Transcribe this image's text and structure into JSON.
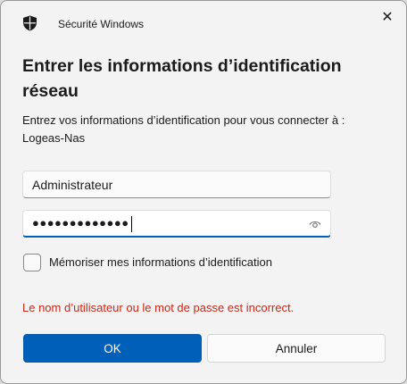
{
  "window": {
    "title": "Sécurité Windows",
    "close_glyph": "✕"
  },
  "dialog": {
    "heading_line1": "Entrer les informations d’identification",
    "heading_line2": "réseau",
    "description_line1": "Entrez vos informations d’identification pour vous connecter à :",
    "description_line2": "Logeas-Nas"
  },
  "form": {
    "username_value": "Administrateur",
    "password_masked": "●●●●●●●●●●●●●",
    "remember_label": "Mémoriser mes informations d’identification",
    "remember_checked": false
  },
  "error_message": "Le nom d’utilisateur ou le mot de passe est incorrect.",
  "buttons": {
    "ok_label": "OK",
    "cancel_label": "Annuler"
  },
  "icons": {
    "app": "shield-icon",
    "close": "close-icon",
    "reveal": "eye-icon"
  },
  "colors": {
    "accent": "#005fb8",
    "error": "#c42b1c",
    "background": "#f3f3f3"
  }
}
